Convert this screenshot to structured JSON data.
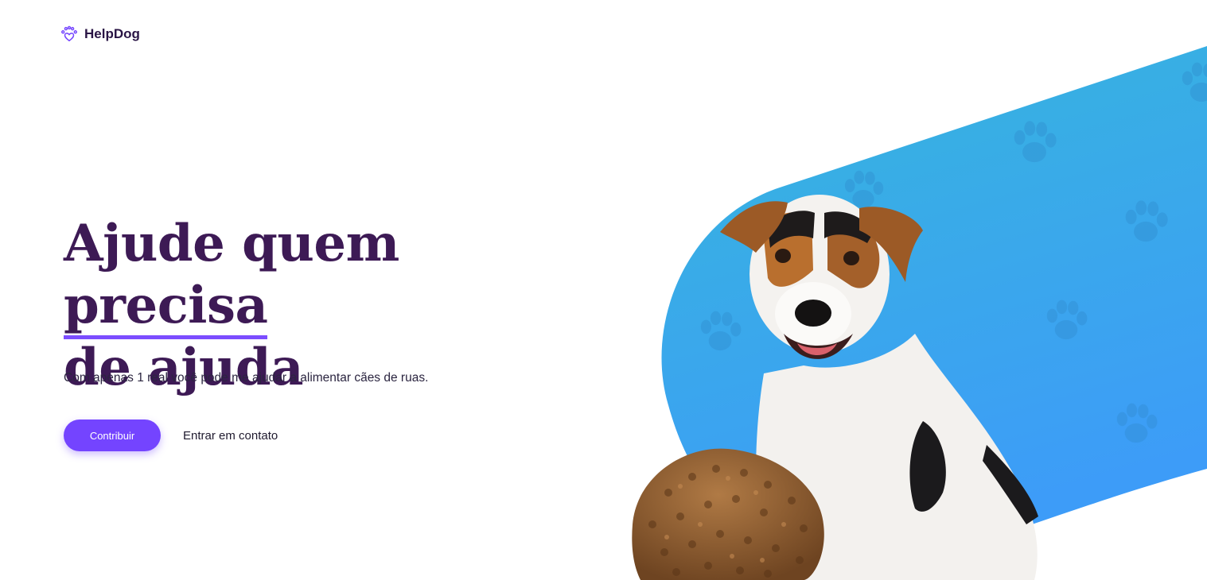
{
  "brand": {
    "name": "HelpDog",
    "icon": "paw-heart-icon",
    "accent_color": "#7444ff"
  },
  "hero": {
    "title_before": "Ajude quem ",
    "title_highlight": "precisa",
    "title_after": "de ajuda",
    "subtitle": "Com apenas 1 real você pode me ajudar a alimentar cães de ruas.",
    "title_color": "#3d1a55"
  },
  "actions": {
    "primary_label": "Contribuir",
    "secondary_label": "Entrar em contato"
  },
  "illustration": {
    "background_colors": [
      "#36b6dc",
      "#3d9cf8"
    ],
    "pattern_icon": "paw-print-icon",
    "subject": "dog-photo",
    "food": "kibble-pile"
  }
}
